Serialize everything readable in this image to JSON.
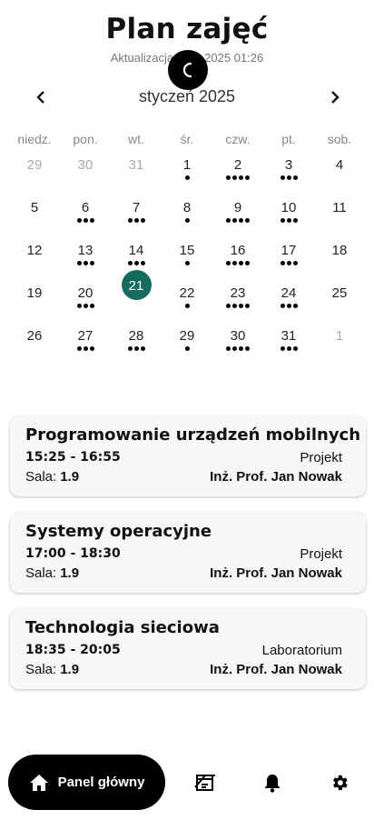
{
  "header": {
    "title": "Plan zajęć",
    "updated_left": "Aktualizacja",
    "updated_right": "01.2025 01:26"
  },
  "calendar": {
    "month_label": "styczeń 2025",
    "weekdays": [
      "niedz.",
      "pon.",
      "wt.",
      "śr.",
      "czw.",
      "pt.",
      "sob."
    ],
    "weeks": [
      [
        {
          "d": "29",
          "other": true,
          "dots": 0
        },
        {
          "d": "30",
          "other": true,
          "dots": 0
        },
        {
          "d": "31",
          "other": true,
          "dots": 0
        },
        {
          "d": "1",
          "dots": 1
        },
        {
          "d": "2",
          "dots": 4
        },
        {
          "d": "3",
          "dots": 3
        },
        {
          "d": "4",
          "dots": 0
        }
      ],
      [
        {
          "d": "5",
          "dots": 0
        },
        {
          "d": "6",
          "dots": 3
        },
        {
          "d": "7",
          "dots": 3
        },
        {
          "d": "8",
          "dots": 1
        },
        {
          "d": "9",
          "dots": 4
        },
        {
          "d": "10",
          "dots": 3
        },
        {
          "d": "11",
          "dots": 0
        }
      ],
      [
        {
          "d": "12",
          "dots": 0
        },
        {
          "d": "13",
          "dots": 3
        },
        {
          "d": "14",
          "dots": 3
        },
        {
          "d": "15",
          "dots": 1
        },
        {
          "d": "16",
          "dots": 4
        },
        {
          "d": "17",
          "dots": 3
        },
        {
          "d": "18",
          "dots": 0
        }
      ],
      [
        {
          "d": "19",
          "dots": 0
        },
        {
          "d": "20",
          "dots": 3
        },
        {
          "d": "21",
          "dots": 0,
          "selected": true
        },
        {
          "d": "22",
          "dots": 1
        },
        {
          "d": "23",
          "dots": 4
        },
        {
          "d": "24",
          "dots": 3
        },
        {
          "d": "25",
          "dots": 0
        }
      ],
      [
        {
          "d": "26",
          "dots": 0
        },
        {
          "d": "27",
          "dots": 3
        },
        {
          "d": "28",
          "dots": 3
        },
        {
          "d": "29",
          "dots": 1
        },
        {
          "d": "30",
          "dots": 4
        },
        {
          "d": "31",
          "dots": 3
        },
        {
          "d": "1",
          "other": true,
          "dots": 0
        }
      ]
    ],
    "selected_color": "#166b5f"
  },
  "classes": [
    {
      "title": "Programowanie urządzeń mobilnych",
      "time": "15:25 - 16:55",
      "type": "Projekt",
      "room_label": "Sala:",
      "room": "1.9",
      "teacher": "Inż. Prof. Jan Nowak"
    },
    {
      "title": "Systemy operacyjne",
      "time": "17:00 - 18:30",
      "type": "Projekt",
      "room_label": "Sala:",
      "room": "1.9",
      "teacher": "Inż. Prof. Jan Nowak"
    },
    {
      "title": "Technologia sieciowa",
      "time": "18:35 - 20:05",
      "type": "Laboratorium",
      "room_label": "Sala:",
      "room": "1.9",
      "teacher": "Inż. Prof. Jan Nowak"
    }
  ],
  "bottom_nav": {
    "home_label": "Panel główny",
    "icons": [
      "home-icon",
      "schedule-sync-icon",
      "bell-icon",
      "gear-icon"
    ]
  }
}
